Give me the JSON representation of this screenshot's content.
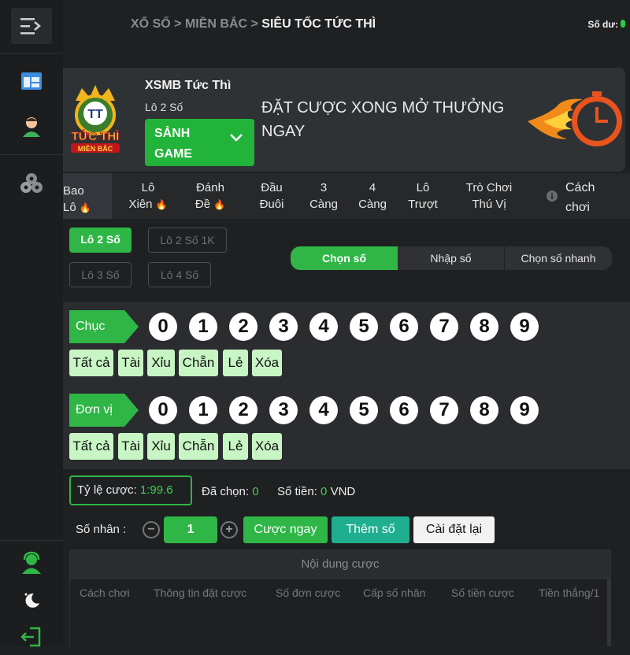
{
  "sidebar": {
    "items": [
      {
        "name": "menu-toggle",
        "icon": "menu-collapse-icon"
      },
      {
        "name": "dashboard",
        "icon": "dashboard-icon"
      },
      {
        "name": "account",
        "icon": "user-icon"
      },
      {
        "name": "games",
        "icon": "game-balls-icon"
      },
      {
        "name": "support",
        "icon": "support-agent-icon"
      },
      {
        "name": "theme",
        "icon": "moon-icon"
      },
      {
        "name": "logout",
        "icon": "logout-icon"
      }
    ]
  },
  "breadcrumb": {
    "part1": "XỔ SỐ",
    "sep": ">",
    "part2": "MIỀN BẮC",
    "current": "SIÊU TỐC TỨC THÌ"
  },
  "balance_label": "Số dư:",
  "banner": {
    "logo_text_top": "TT",
    "logo_text_mid": "TỨC THÌ",
    "logo_text_bottom": "MIỀN BẮC",
    "title": "XSMB Tức Thì",
    "subtitle": "Lô 2 Số",
    "hall_button_line1": "SẢNH",
    "hall_button_line2": "GAME",
    "slogan": "ĐẶT CƯỢC XONG MỞ THƯỞNG NGAY"
  },
  "tabs": [
    {
      "line1": "Bao",
      "line2": "Lô",
      "hot": true
    },
    {
      "line1": "Lô",
      "line2": "Xiên",
      "hot": true
    },
    {
      "line1": "Đánh",
      "line2": "Đề",
      "hot": true
    },
    {
      "line1": "Đầu",
      "line2": "Đuôi",
      "hot": false
    },
    {
      "line1": "3",
      "line2": "Càng",
      "hot": false
    },
    {
      "line1": "4",
      "line2": "Càng",
      "hot": false
    },
    {
      "line1": "Lô",
      "line2": "Trượt",
      "hot": false
    },
    {
      "line1": "Trò Chơi",
      "line2": "Thú Vị",
      "hot": false
    }
  ],
  "help_tab": {
    "line1": "Cách",
    "line2": "chơi"
  },
  "sub_types": [
    "Lô 2 Số",
    "Lô 2 Số 1K",
    "Lô 3 Số",
    "Lô 4 Số"
  ],
  "input_modes": [
    "Chọn số",
    "Nhập số",
    "Chọn số nhanh"
  ],
  "rows": [
    {
      "label": "Chục",
      "digits": [
        "0",
        "1",
        "2",
        "3",
        "4",
        "5",
        "6",
        "7",
        "8",
        "9"
      ],
      "quick": [
        "Tất cả",
        "Tài",
        "Xỉu",
        "Chẵn",
        "Lẻ",
        "Xóa"
      ]
    },
    {
      "label": "Đơn vị",
      "digits": [
        "0",
        "1",
        "2",
        "3",
        "4",
        "5",
        "6",
        "7",
        "8",
        "9"
      ],
      "quick": [
        "Tất cả",
        "Tài",
        "Xỉu",
        "Chẵn",
        "Lẻ",
        "Xóa"
      ]
    }
  ],
  "bet": {
    "rate_label": "Tỷ lệ cược:",
    "rate_value": "1:99.6",
    "selected_label": "Đã chọn:",
    "selected_value": "0",
    "amount_label": "Số tiền:",
    "amount_value": "0",
    "currency": "VND"
  },
  "multiplier": {
    "label": "Số nhân :",
    "minus": "−",
    "value": "1",
    "plus": "+",
    "bet_now": "Cược ngay",
    "add_number": "Thêm số",
    "reset": "Cài đặt lại"
  },
  "content": {
    "title": "Nội dung cược",
    "columns": [
      "Cách chơi",
      "Thông tin đặt cược",
      "Số đơn cược",
      "Cấp số nhân",
      "Số tiền cược",
      "Tiền thắng/1"
    ]
  },
  "colors": {
    "accent": "#2fb646",
    "background": "#1f2022",
    "panel": "#2a2c2f",
    "quick_button": "#c8f5c4",
    "teal": "#1fae8f"
  }
}
